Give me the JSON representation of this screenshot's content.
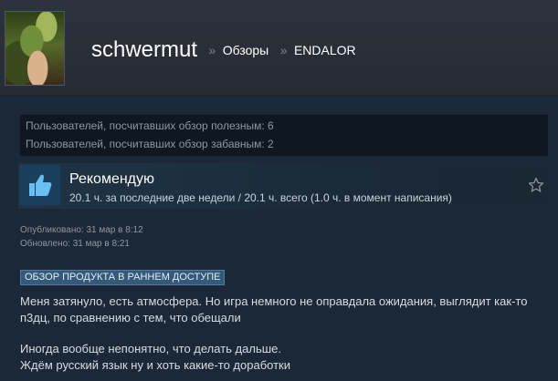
{
  "header": {
    "username": "schwermut",
    "separator": "»",
    "breadcrumb_reviews": "Обзоры",
    "breadcrumb_game": "ENDALOR"
  },
  "ratings": {
    "helpful": "Пользователей, посчитавших обзор полезным: 6",
    "funny": "Пользователей, посчитавших обзор забавным: 2"
  },
  "review": {
    "verdict": "Рекомендую",
    "hours": "20.1 ч. за последние две недели / 20.1 ч. всего (1.0 ч. в момент написания)",
    "thumb_icon": "thumbs-up-icon",
    "favorite_icon": "star-icon",
    "published": "Опубликовано: 31 мар в 8:12",
    "updated": "Обновлено: 31 мар в 8:21",
    "early_access_badge": "ОБЗОР ПРОДУКТА В РАННЕМ ДОСТУПЕ",
    "text_line1": "Меня затянуло, есть атмосфера. Но игра немного не оправдала ожидания, выглядит как-то",
    "text_line2": "п3дц, по сравнению с тем, что обещали",
    "text_line3": "Иногда вообще непонятно, что делать дальше.",
    "text_line4": "Ждём русский язык ну и хоть какие-то доработки"
  },
  "colors": {
    "page_bg": "#1b2838",
    "header_bg": "#2c323c",
    "thumb_bg": "#1a3f5c",
    "thumb_icon": "#66c0f4",
    "badge_bg": "#355978"
  }
}
